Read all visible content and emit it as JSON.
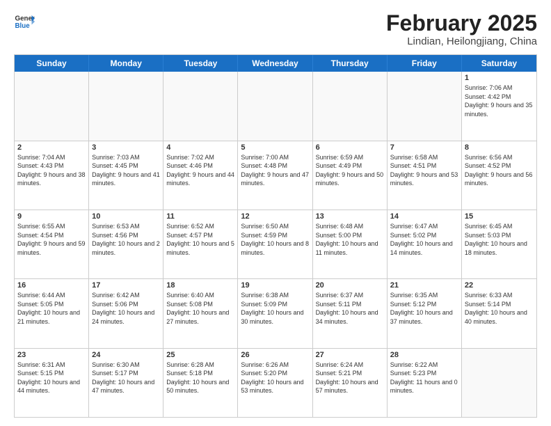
{
  "header": {
    "logo_general": "General",
    "logo_blue": "Blue",
    "month_year": "February 2025",
    "location": "Lindian, Heilongjiang, China"
  },
  "days_of_week": [
    "Sunday",
    "Monday",
    "Tuesday",
    "Wednesday",
    "Thursday",
    "Friday",
    "Saturday"
  ],
  "weeks": [
    [
      {
        "day": "",
        "empty": true
      },
      {
        "day": "",
        "empty": true
      },
      {
        "day": "",
        "empty": true
      },
      {
        "day": "",
        "empty": true
      },
      {
        "day": "",
        "empty": true
      },
      {
        "day": "",
        "empty": true
      },
      {
        "day": "1",
        "sunrise": "Sunrise: 7:06 AM",
        "sunset": "Sunset: 4:42 PM",
        "daylight": "Daylight: 9 hours and 35 minutes."
      }
    ],
    [
      {
        "day": "2",
        "sunrise": "Sunrise: 7:04 AM",
        "sunset": "Sunset: 4:43 PM",
        "daylight": "Daylight: 9 hours and 38 minutes."
      },
      {
        "day": "3",
        "sunrise": "Sunrise: 7:03 AM",
        "sunset": "Sunset: 4:45 PM",
        "daylight": "Daylight: 9 hours and 41 minutes."
      },
      {
        "day": "4",
        "sunrise": "Sunrise: 7:02 AM",
        "sunset": "Sunset: 4:46 PM",
        "daylight": "Daylight: 9 hours and 44 minutes."
      },
      {
        "day": "5",
        "sunrise": "Sunrise: 7:00 AM",
        "sunset": "Sunset: 4:48 PM",
        "daylight": "Daylight: 9 hours and 47 minutes."
      },
      {
        "day": "6",
        "sunrise": "Sunrise: 6:59 AM",
        "sunset": "Sunset: 4:49 PM",
        "daylight": "Daylight: 9 hours and 50 minutes."
      },
      {
        "day": "7",
        "sunrise": "Sunrise: 6:58 AM",
        "sunset": "Sunset: 4:51 PM",
        "daylight": "Daylight: 9 hours and 53 minutes."
      },
      {
        "day": "8",
        "sunrise": "Sunrise: 6:56 AM",
        "sunset": "Sunset: 4:52 PM",
        "daylight": "Daylight: 9 hours and 56 minutes."
      }
    ],
    [
      {
        "day": "9",
        "sunrise": "Sunrise: 6:55 AM",
        "sunset": "Sunset: 4:54 PM",
        "daylight": "Daylight: 9 hours and 59 minutes."
      },
      {
        "day": "10",
        "sunrise": "Sunrise: 6:53 AM",
        "sunset": "Sunset: 4:56 PM",
        "daylight": "Daylight: 10 hours and 2 minutes."
      },
      {
        "day": "11",
        "sunrise": "Sunrise: 6:52 AM",
        "sunset": "Sunset: 4:57 PM",
        "daylight": "Daylight: 10 hours and 5 minutes."
      },
      {
        "day": "12",
        "sunrise": "Sunrise: 6:50 AM",
        "sunset": "Sunset: 4:59 PM",
        "daylight": "Daylight: 10 hours and 8 minutes."
      },
      {
        "day": "13",
        "sunrise": "Sunrise: 6:48 AM",
        "sunset": "Sunset: 5:00 PM",
        "daylight": "Daylight: 10 hours and 11 minutes."
      },
      {
        "day": "14",
        "sunrise": "Sunrise: 6:47 AM",
        "sunset": "Sunset: 5:02 PM",
        "daylight": "Daylight: 10 hours and 14 minutes."
      },
      {
        "day": "15",
        "sunrise": "Sunrise: 6:45 AM",
        "sunset": "Sunset: 5:03 PM",
        "daylight": "Daylight: 10 hours and 18 minutes."
      }
    ],
    [
      {
        "day": "16",
        "sunrise": "Sunrise: 6:44 AM",
        "sunset": "Sunset: 5:05 PM",
        "daylight": "Daylight: 10 hours and 21 minutes."
      },
      {
        "day": "17",
        "sunrise": "Sunrise: 6:42 AM",
        "sunset": "Sunset: 5:06 PM",
        "daylight": "Daylight: 10 hours and 24 minutes."
      },
      {
        "day": "18",
        "sunrise": "Sunrise: 6:40 AM",
        "sunset": "Sunset: 5:08 PM",
        "daylight": "Daylight: 10 hours and 27 minutes."
      },
      {
        "day": "19",
        "sunrise": "Sunrise: 6:38 AM",
        "sunset": "Sunset: 5:09 PM",
        "daylight": "Daylight: 10 hours and 30 minutes."
      },
      {
        "day": "20",
        "sunrise": "Sunrise: 6:37 AM",
        "sunset": "Sunset: 5:11 PM",
        "daylight": "Daylight: 10 hours and 34 minutes."
      },
      {
        "day": "21",
        "sunrise": "Sunrise: 6:35 AM",
        "sunset": "Sunset: 5:12 PM",
        "daylight": "Daylight: 10 hours and 37 minutes."
      },
      {
        "day": "22",
        "sunrise": "Sunrise: 6:33 AM",
        "sunset": "Sunset: 5:14 PM",
        "daylight": "Daylight: 10 hours and 40 minutes."
      }
    ],
    [
      {
        "day": "23",
        "sunrise": "Sunrise: 6:31 AM",
        "sunset": "Sunset: 5:15 PM",
        "daylight": "Daylight: 10 hours and 44 minutes."
      },
      {
        "day": "24",
        "sunrise": "Sunrise: 6:30 AM",
        "sunset": "Sunset: 5:17 PM",
        "daylight": "Daylight: 10 hours and 47 minutes."
      },
      {
        "day": "25",
        "sunrise": "Sunrise: 6:28 AM",
        "sunset": "Sunset: 5:18 PM",
        "daylight": "Daylight: 10 hours and 50 minutes."
      },
      {
        "day": "26",
        "sunrise": "Sunrise: 6:26 AM",
        "sunset": "Sunset: 5:20 PM",
        "daylight": "Daylight: 10 hours and 53 minutes."
      },
      {
        "day": "27",
        "sunrise": "Sunrise: 6:24 AM",
        "sunset": "Sunset: 5:21 PM",
        "daylight": "Daylight: 10 hours and 57 minutes."
      },
      {
        "day": "28",
        "sunrise": "Sunrise: 6:22 AM",
        "sunset": "Sunset: 5:23 PM",
        "daylight": "Daylight: 11 hours and 0 minutes."
      },
      {
        "day": "",
        "empty": true
      }
    ]
  ]
}
